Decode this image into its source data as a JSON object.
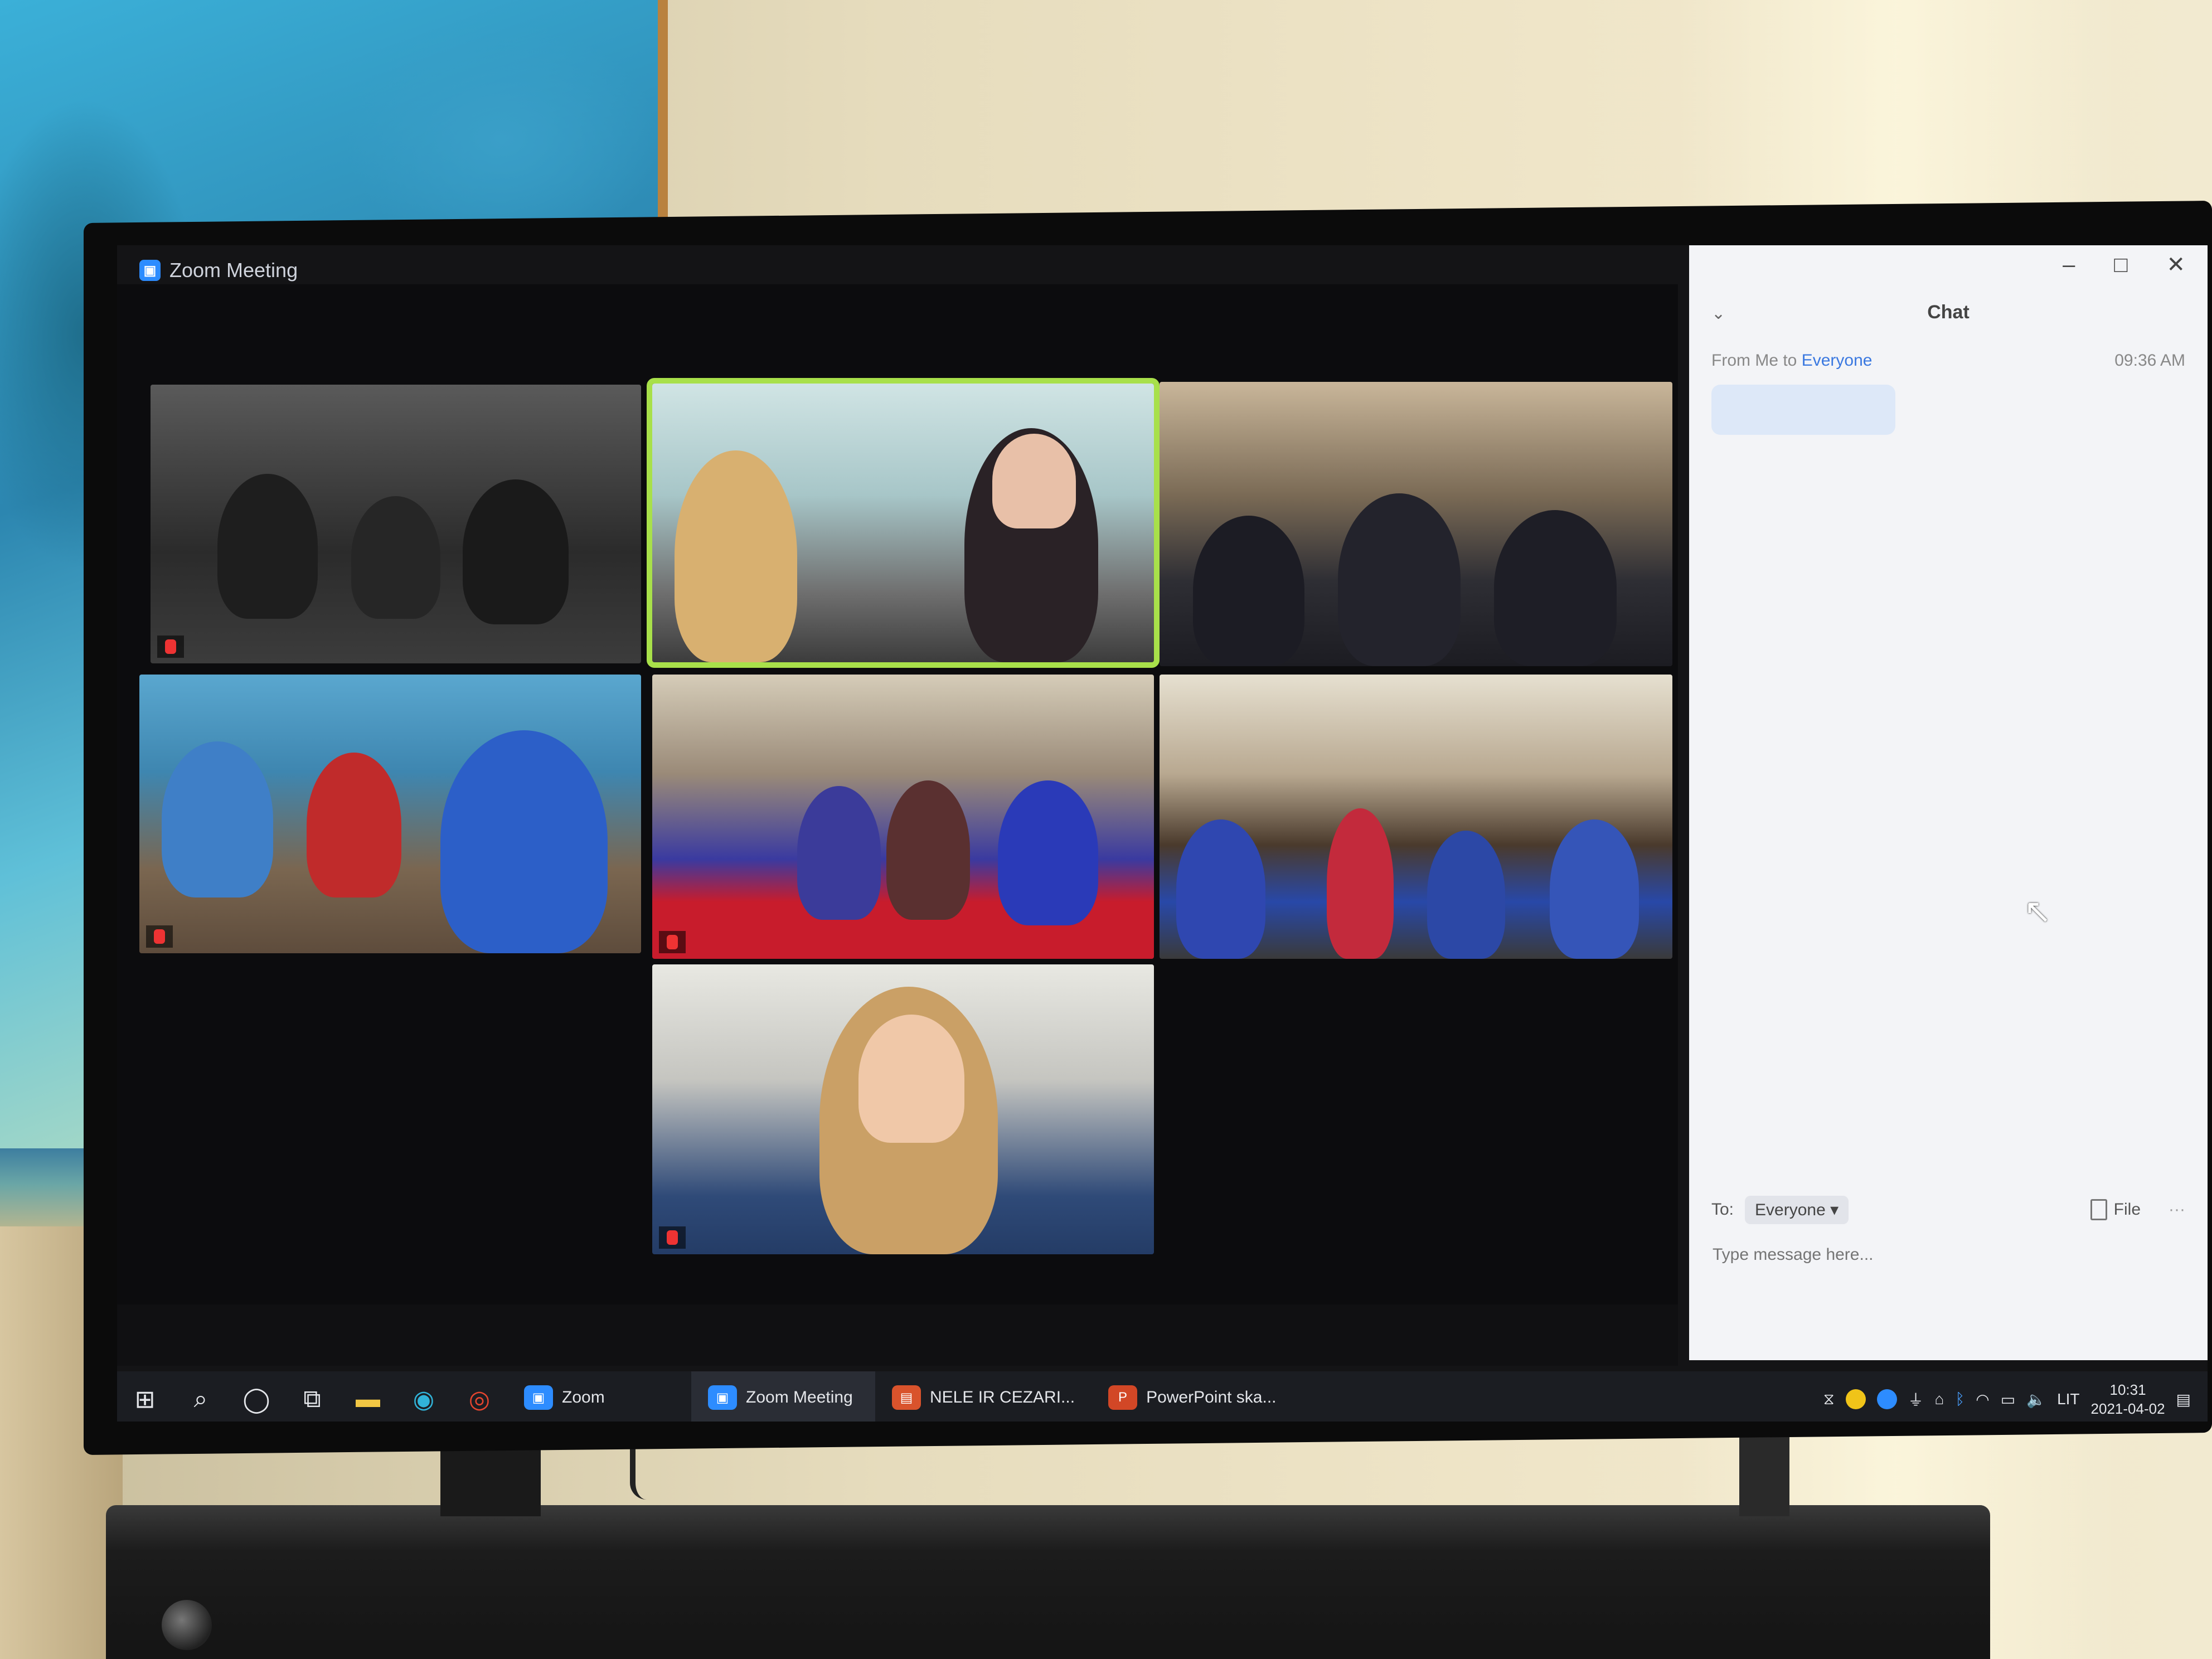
{
  "window": {
    "title": "Zoom Meeting"
  },
  "chat": {
    "header": "Chat",
    "message_from_label": "From Me to",
    "message_to": "Everyone",
    "message_time": "09:36 AM",
    "to_label": "To:",
    "recipient": "Everyone",
    "file_label": "File",
    "input_placeholder": "Type message here..."
  },
  "taskbar": {
    "apps": [
      {
        "label": "Zoom",
        "color": "#2d8cff"
      },
      {
        "label": "Zoom Meeting",
        "color": "#2d8cff"
      },
      {
        "label": "NELE IR CEZARI...",
        "color": "#d9532c"
      },
      {
        "label": "PowerPoint ska...",
        "color": "#d24726"
      }
    ],
    "language": "LIT",
    "time": "10:31",
    "date": "2021-04-02"
  },
  "colors": {
    "active_speaker": "#a8e04a",
    "zoom_blue": "#2d8cff",
    "chat_link": "#3a78e0"
  }
}
